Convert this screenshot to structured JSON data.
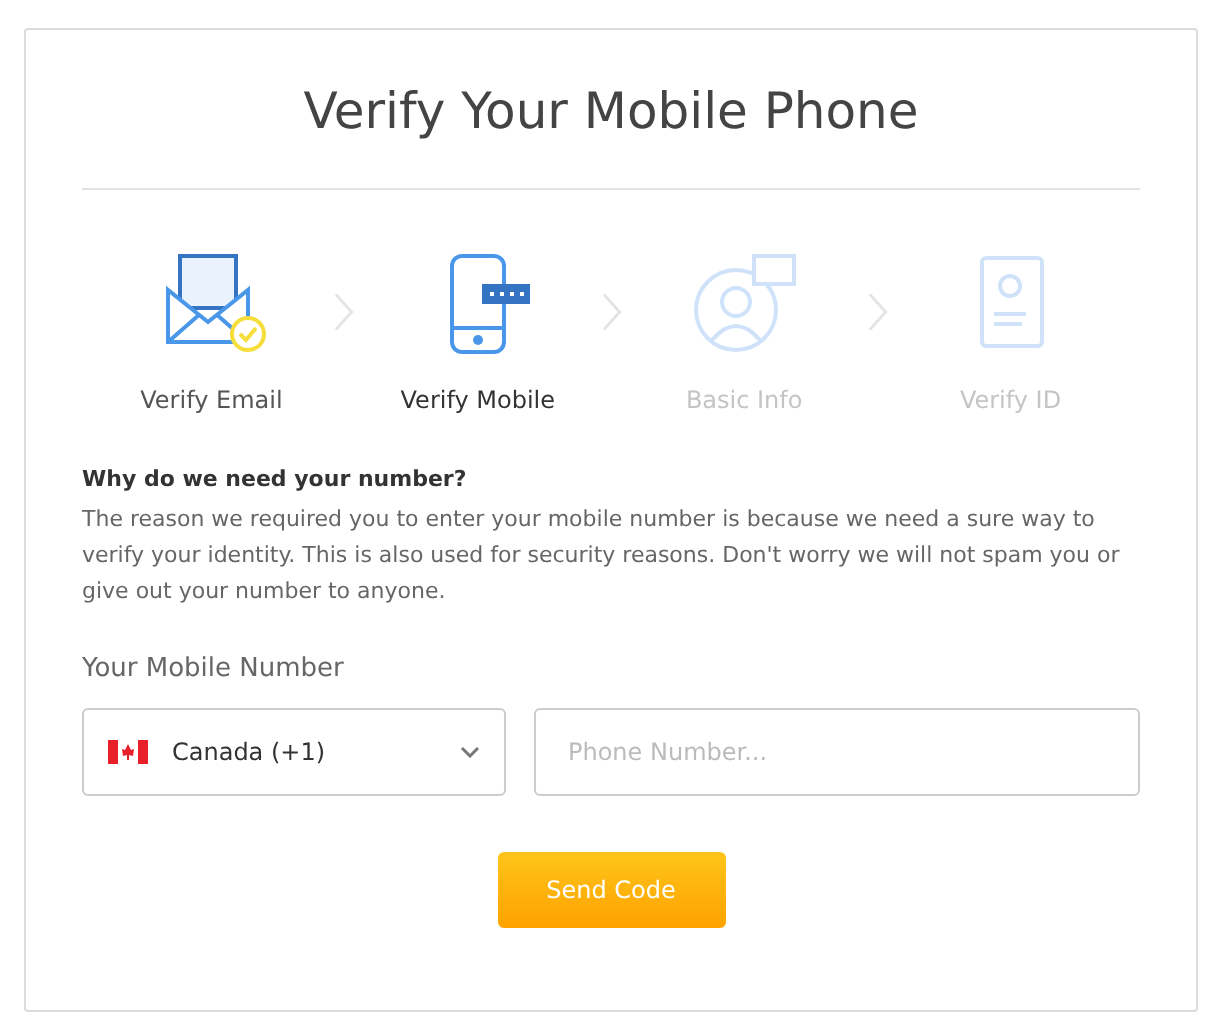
{
  "title": "Verify Your Mobile Phone",
  "steps": [
    {
      "kind": "email",
      "label": "Verify Email",
      "completed": true,
      "selected": false
    },
    {
      "kind": "mobile",
      "label": "Verify Mobile",
      "completed": false,
      "selected": true
    },
    {
      "kind": "profile",
      "label": "Basic Info",
      "completed": false,
      "selected": false
    },
    {
      "kind": "id",
      "label": "Verify ID",
      "completed": false,
      "selected": false
    }
  ],
  "info": {
    "heading": "Why do we need your number?",
    "body": "The reason we required you to enter your mobile number is because we need a sure way to verify your identity. This is also used for security reasons. Don't worry we will not spam you or give out your number to anyone."
  },
  "form": {
    "label": "Your Mobile Number",
    "country": "Canada (+1)",
    "phone_placeholder": "Phone Number..."
  },
  "button": "Send Code"
}
